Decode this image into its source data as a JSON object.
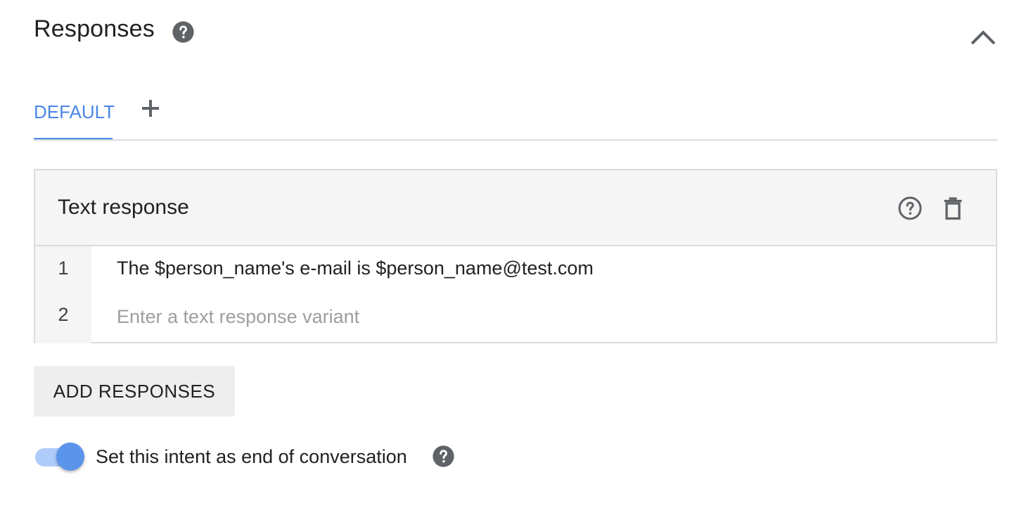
{
  "header": {
    "title": "Responses",
    "help_icon": "help-circle-filled-icon",
    "collapse_icon": "chevron-up-icon"
  },
  "tabs": {
    "items": [
      {
        "label": "DEFAULT",
        "active": true
      }
    ],
    "add_icon": "plus-icon"
  },
  "card": {
    "title": "Text response",
    "help_icon": "help-circle-outline-icon",
    "delete_icon": "trash-icon",
    "rows": [
      {
        "number": "1",
        "text": "The $person_name's e-mail is $person_name@test.com"
      },
      {
        "number": "2",
        "placeholder": "Enter a text response variant"
      }
    ]
  },
  "add_button": {
    "label": "ADD RESPONSES"
  },
  "end_conversation": {
    "label": "Set this intent as end of conversation",
    "enabled": true,
    "help_icon": "help-circle-filled-icon"
  },
  "colors": {
    "accent": "#4a86e8",
    "toggle_track": "#aecbfa",
    "toggle_knob": "#5b95eb",
    "icon": "#5f6368",
    "card_header_bg": "#f5f5f5",
    "border": "#dadce0"
  }
}
